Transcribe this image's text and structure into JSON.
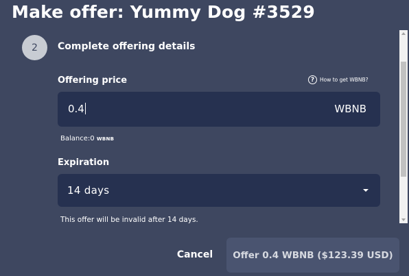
{
  "modal": {
    "title": "Make offer: Yummy Dog #3529"
  },
  "step": {
    "number": "2",
    "title": "Complete offering details"
  },
  "offering_price": {
    "label": "Offering price",
    "help_text": "How to get WBNB?",
    "value": "0.4",
    "unit": "WBNB",
    "balance_label": "Balance:",
    "balance_value": "0",
    "balance_unit": "WBNB"
  },
  "expiration": {
    "label": "Expiration",
    "selected": "14 days",
    "note": "This offer will be invalid after 14 days."
  },
  "actions": {
    "cancel_label": "Cancel",
    "offer_label": "Offer 0.4 WBNB ($123.39 USD)"
  },
  "icons": {
    "help": "question-circle-icon",
    "dropdown": "caret-down-icon"
  },
  "colors": {
    "background": "#3e4760",
    "input_background": "#263150",
    "step_circle": "#c8ccd3",
    "offer_button": "#4a5470"
  }
}
